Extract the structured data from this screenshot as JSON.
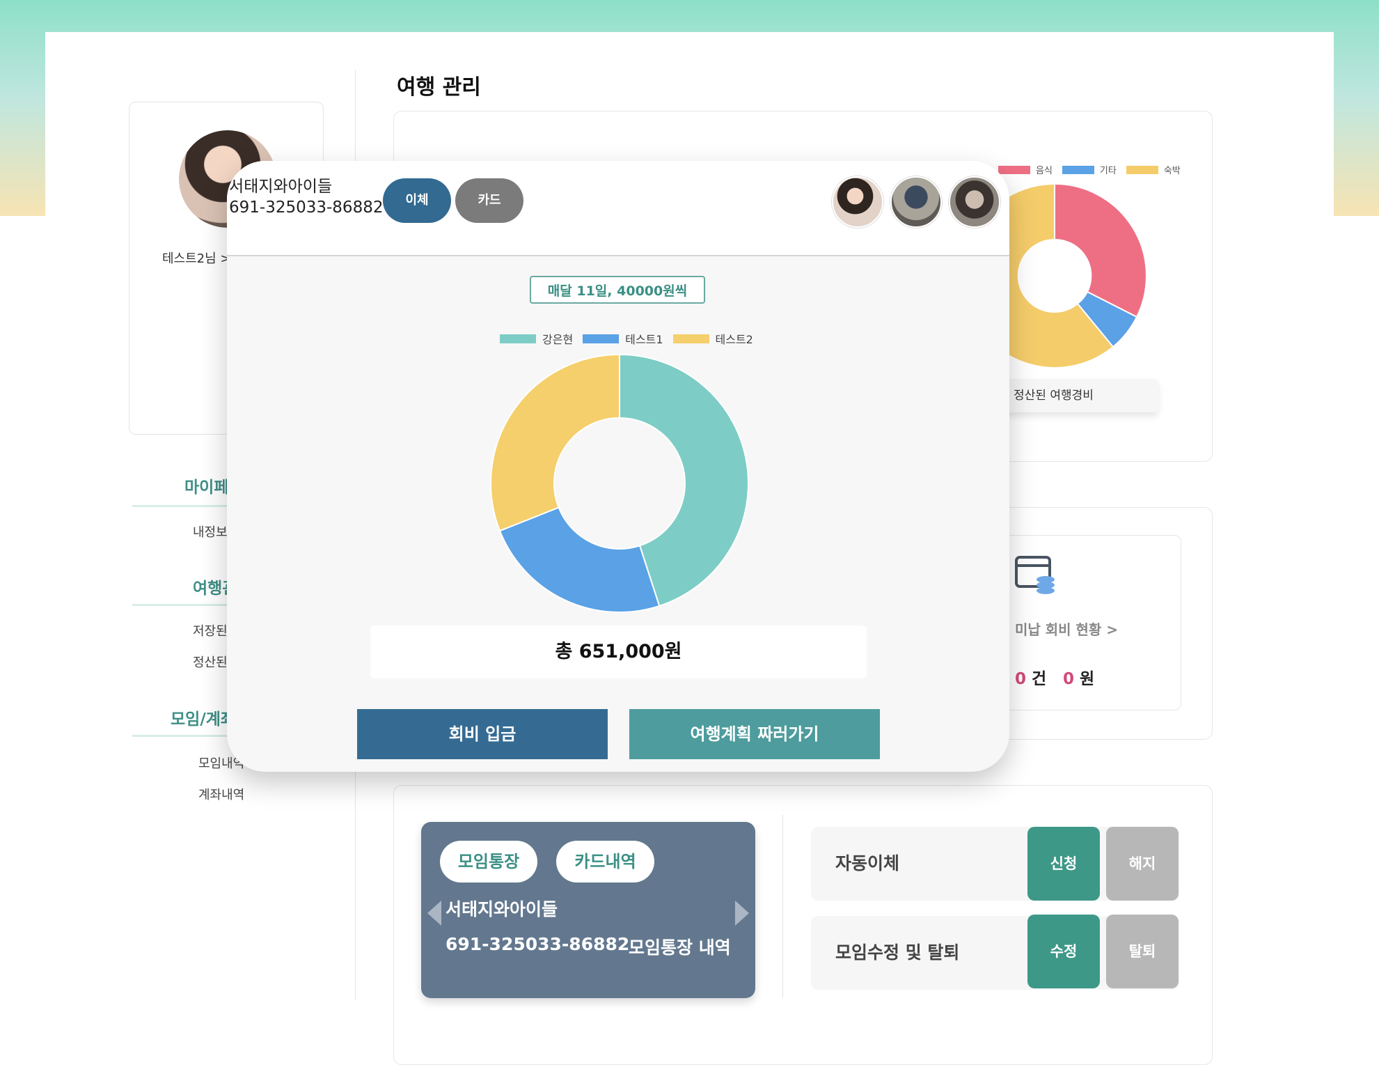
{
  "page": {
    "title": "여행 관리"
  },
  "profile": {
    "name": "테스트2님 >"
  },
  "nav": {
    "sections": [
      {
        "heading": "마이페이지",
        "items": [
          "내정보"
        ]
      },
      {
        "heading": "여행관리",
        "items": [
          "저장된",
          "정산된"
        ]
      },
      {
        "heading": "모임/계좌",
        "items": [
          "모임내역",
          "계좌내역"
        ]
      }
    ]
  },
  "bg_chart": {
    "legend": [
      "음식",
      "기타",
      "숙박"
    ],
    "caption": "정산된 여행경비",
    "colors": {
      "food": "#ee6f84",
      "etc": "#5aa1e6",
      "stay": "#f5cc6a"
    }
  },
  "unpaid": {
    "title": "미납 회비 현황 >",
    "count": "0",
    "count_unit": "건",
    "amount": "0",
    "amount_unit": "원"
  },
  "account_card": {
    "tabs": [
      "모임통장",
      "카드내역"
    ],
    "group_name": "서태지와아이들",
    "account_number": "691-325033-86882",
    "history_link": "모임통장 내역"
  },
  "options": [
    {
      "label": "자동이체",
      "primary": "신청",
      "secondary": "해지"
    },
    {
      "label": "모임수정 및 탈퇴",
      "primary": "수정",
      "secondary": "탈퇴"
    }
  ],
  "modal": {
    "group_name": "서태지와아이들",
    "account_number": "691-325033-86882",
    "pay_types": [
      "이체",
      "카드"
    ],
    "monthly": "매달 11일, 40000원씩",
    "total": "총 651,000원",
    "actions": [
      "회비 입금",
      "여행계획 짜러가기"
    ]
  },
  "chart_data": {
    "type": "pie",
    "variant": "doughnut",
    "categories": [
      "강은현",
      "테스트1",
      "테스트2"
    ],
    "values": [
      0.45,
      0.24,
      0.31
    ],
    "colors": [
      "#7dcdc6",
      "#5aa1e6",
      "#f5cf6b"
    ],
    "legend": "top"
  },
  "colors": {
    "primary_blue": "#356b93",
    "teal": "#4e9c9d",
    "green": "#3e9888",
    "grey": "#b7b7b7",
    "pill_blue": "#336a91",
    "pill_grey": "#7b7b7b"
  }
}
